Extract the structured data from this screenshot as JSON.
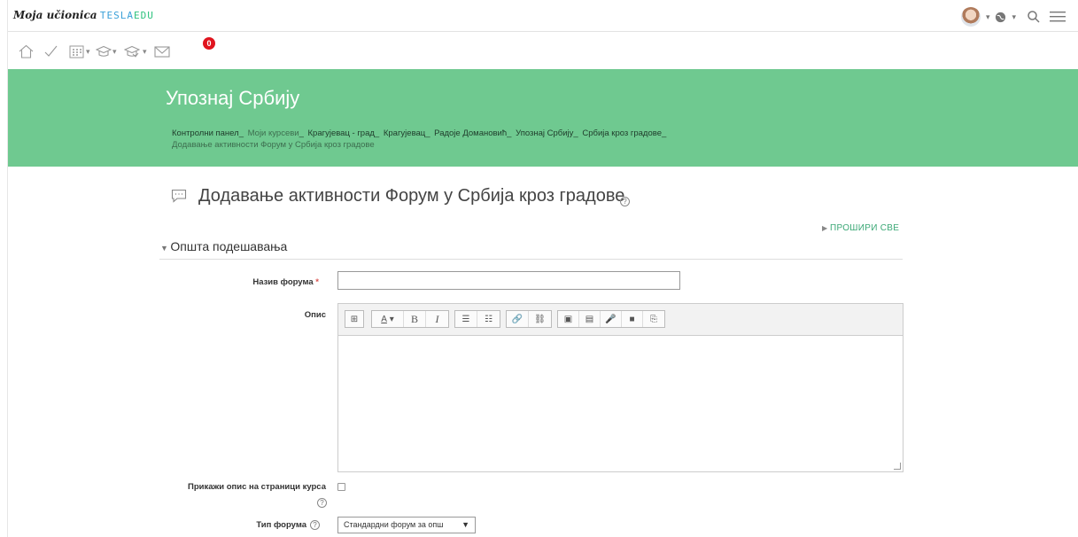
{
  "brand": {
    "moja": "Moja učionica",
    "tesla": "TESLA",
    "edu": "EDU"
  },
  "icons": {
    "home": "home-icon",
    "check": "check-icon",
    "calendar": "calendar-icon",
    "courses": "graduation-cap-icon",
    "grades": "grades-icon",
    "messages": "mail-icon",
    "language": "globe-icon",
    "search": "search-icon",
    "menu": "hamburger-icon"
  },
  "topbar": {
    "caret": "▾"
  },
  "iconrow": {
    "message_count": "0"
  },
  "header": {
    "course_title": "Упознај Србију",
    "breadcrumbs": [
      "Контролни панел",
      "Моји курсеви",
      "Крагујевац - град",
      "Крагујевац",
      "Радоје Домановић",
      "Упознај Србију",
      "Србија кроз градове",
      "Додавање активности Форум у Србија кроз градове"
    ]
  },
  "page": {
    "title": "Додавање активности Форум у Србија кроз градове",
    "expand_all": "ПРОШИРИ СВЕ",
    "section_title": "Општа подешавања"
  },
  "form": {
    "forum_name_label": "Назив форума",
    "required_mark": "*",
    "forum_name_value": "",
    "description_label": "Опис",
    "show_description_label": "Прикажи опис на страници курса",
    "show_description_checked": false,
    "forum_type_label": "Тип форума",
    "forum_type_value": "Стандардни форум за опш"
  },
  "editor_toolbar": {
    "buttons": [
      "⊞",
      "A",
      "B",
      "I",
      "☰",
      "☷",
      "🔗",
      "⛓",
      "▣",
      "▤",
      "🎤",
      "■",
      "⎘"
    ]
  },
  "colors": {
    "band": "#6fc990",
    "accent": "#3ba876",
    "badge": "#e0141e"
  }
}
